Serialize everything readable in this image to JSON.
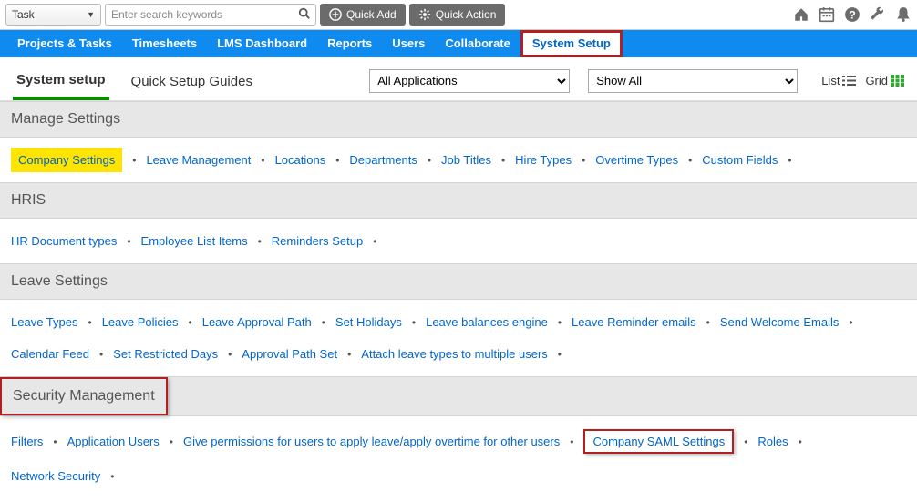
{
  "toolbar": {
    "task_label": "Task",
    "search_placeholder": "Enter search keywords",
    "quick_add": "Quick Add",
    "quick_action": "Quick Action"
  },
  "nav": {
    "items": [
      "Projects & Tasks",
      "Timesheets",
      "LMS Dashboard",
      "Reports",
      "Users",
      "Collaborate",
      "System Setup"
    ]
  },
  "sub_tabs": {
    "active": "System setup",
    "other": "Quick Setup Guides",
    "app_filter": "All Applications",
    "show_filter": "Show All",
    "list_label": "List",
    "grid_label": "Grid"
  },
  "sections": [
    {
      "title": "Manage Settings",
      "rows": [
        [
          "Company Settings",
          "Leave Management",
          "Locations",
          "Departments",
          "Job Titles",
          "Hire Types",
          "Overtime Types",
          "Custom Fields"
        ]
      ],
      "highlight_yellow": "Company Settings"
    },
    {
      "title": "HRIS",
      "rows": [
        [
          "HR Document types",
          "Employee List Items",
          "Reminders Setup"
        ]
      ]
    },
    {
      "title": "Leave Settings",
      "rows": [
        [
          "Leave Types",
          "Leave Policies",
          "Leave Approval Path",
          "Set Holidays",
          "Leave balances engine",
          "Leave Reminder emails",
          "Send Welcome Emails"
        ],
        [
          "Calendar Feed",
          "Set Restricted Days",
          "Approval Path Set",
          "Attach leave types to multiple users"
        ]
      ]
    },
    {
      "title": "Security Management",
      "title_boxed": true,
      "rows": [
        [
          "Filters",
          "Application Users",
          "Give permissions for users to apply leave/apply overtime for other users",
          "Company SAML Settings",
          "Roles"
        ],
        [
          "Network Security"
        ]
      ],
      "highlight_red": "Company SAML Settings"
    }
  ]
}
